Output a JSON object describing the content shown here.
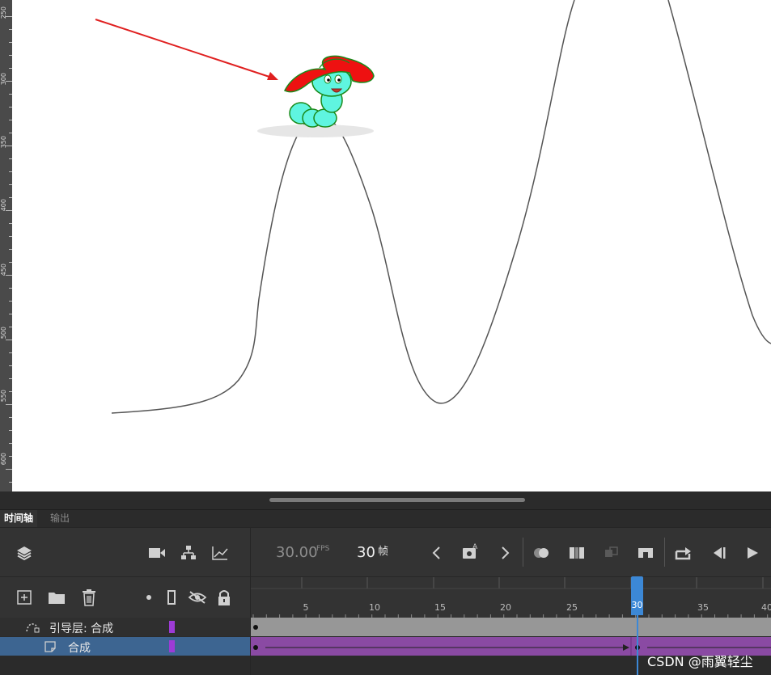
{
  "ruler": {
    "labels": [
      "250",
      "300",
      "350",
      "400",
      "450",
      "500",
      "550",
      "600"
    ]
  },
  "stage": {
    "icons": [
      "arrow-annotation",
      "caterpillar-with-red-hat"
    ]
  },
  "panel_tabs": {
    "timeline": "时间轴",
    "output": "输出"
  },
  "toolbar": {
    "fps_value": "30.00",
    "fps_unit": "FPS",
    "frame_value": "30",
    "frame_unit": "帧",
    "icons": [
      "layers-icon",
      "camera-icon",
      "hierarchy-icon",
      "graph-icon",
      "chevron-left-icon",
      "insert-keyframe-icon",
      "chevron-right-icon",
      "onion-skin-icon",
      "edit-multiple-frames-icon",
      "sync-symbols-icon",
      "center-frame-icon",
      "loop-icon",
      "step-back-icon",
      "play-icon"
    ]
  },
  "layer_tools": {
    "icons": [
      "new-layer-icon",
      "new-folder-icon",
      "delete-icon",
      "dot-icon",
      "outline-icon",
      "eye-hidden-icon",
      "lock-icon"
    ]
  },
  "frame_ruler": {
    "labels": [
      "5",
      "10",
      "15",
      "20",
      "25",
      "30",
      "35",
      "40"
    ],
    "playhead_frame": "30"
  },
  "layers": [
    {
      "name": "引导层: 合成",
      "type": "guide",
      "color": "#9d3bd6",
      "frames_color": "#979797"
    },
    {
      "name": "合成",
      "type": "normal",
      "color": "#9d3bd6",
      "frames_color": "#8a4aa3",
      "selected": true
    }
  ],
  "watermark": "CSDN @雨翼轻尘"
}
